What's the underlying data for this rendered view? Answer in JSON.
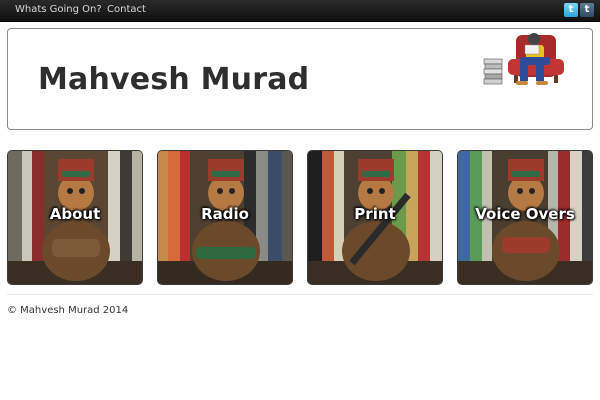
{
  "nav": {
    "items": [
      {
        "label": "Whats Going On?"
      },
      {
        "label": "Contact"
      }
    ],
    "social": [
      {
        "icon": "twitter-icon",
        "glyph": "t",
        "color": "#2ba5d9"
      },
      {
        "icon": "tumblr-icon",
        "glyph": "t",
        "color": "#35465c"
      }
    ]
  },
  "header": {
    "title": "Mahvesh Murad"
  },
  "tiles": [
    {
      "label": "About"
    },
    {
      "label": "Radio"
    },
    {
      "label": "Print"
    },
    {
      "label": "Voice Overs"
    }
  ],
  "footer": {
    "text": "© Mahvesh Murad 2014"
  },
  "colors": {
    "topbar": "#1a1a1a",
    "title": "#2e2e2e"
  }
}
